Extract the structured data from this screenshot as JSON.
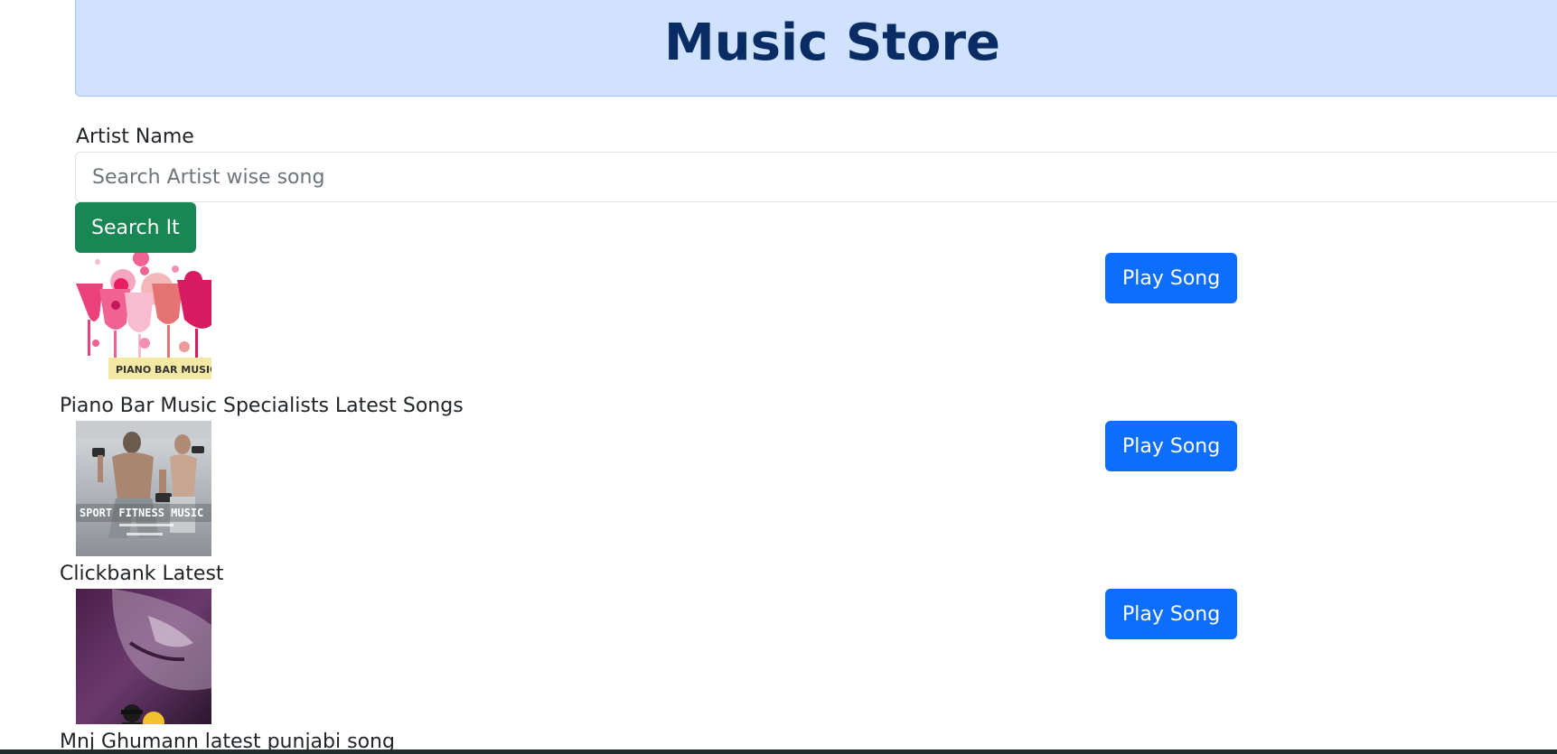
{
  "header": {
    "title": "Music Store"
  },
  "search": {
    "label": "Artist Name",
    "placeholder": "Search Artist wise song",
    "value": "",
    "button_label": "Search It"
  },
  "songs": [
    {
      "title": "Piano Bar Music Specialists Latest Songs",
      "play_label": "Play Song",
      "thumb_text": "PIANO BAR MUSIC"
    },
    {
      "title": "Clickbank Latest",
      "play_label": "Play Song",
      "thumb_text": "SPORT FITNESS MUSIC"
    },
    {
      "title": "Mnj Ghumann latest punjabi song",
      "play_label": "Play Song",
      "thumb_text": ""
    }
  ],
  "colors": {
    "header_bg": "#cfe2ff",
    "header_text": "#0a2c65",
    "search_button": "#198754",
    "play_button": "#0d6efd"
  }
}
